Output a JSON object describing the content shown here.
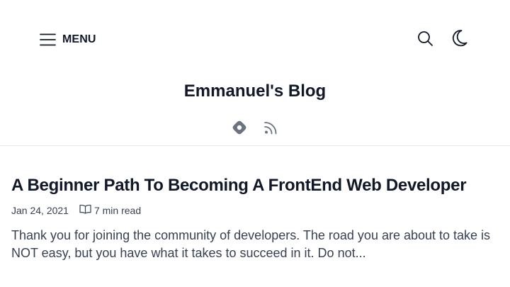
{
  "header": {
    "menu_label": "MENU",
    "menu_icon": "hamburger-icon",
    "search_icon": "search-icon",
    "theme_icon": "moon-icon",
    "blog_title": "Emmanuel's Blog",
    "social_links": [
      {
        "icon": "hashnode-icon"
      },
      {
        "icon": "rss-icon"
      }
    ]
  },
  "post": {
    "title": "A Beginner Path To Becoming A FrontEnd Web Developer",
    "date": "Jan 24, 2021",
    "read_time_icon": "book-icon",
    "read_time": "7 min read",
    "excerpt": "Thank you for joining the community of developers. The road you are about to take is NOT easy, but you have what it takes to succeed in it. Do not..."
  },
  "colors": {
    "text_primary": "#111827",
    "text_secondary": "#374151",
    "icon_gray": "#6b7280",
    "divider": "#e5e7eb",
    "background": "#ffffff"
  }
}
